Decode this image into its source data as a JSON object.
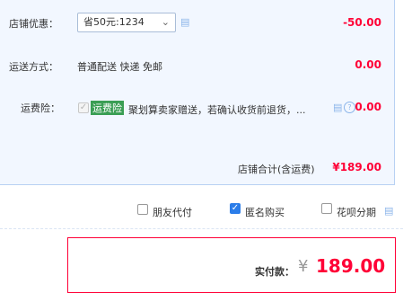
{
  "discount": {
    "label": "店铺优惠：",
    "select_value": "省50元:1234",
    "amount": "-50.00"
  },
  "shipping": {
    "label": "运送方式：",
    "method": "普通配送 快递 免邮",
    "amount": "0.00"
  },
  "insurance": {
    "label": "运费险：",
    "tag": "运费险",
    "description": "聚划算卖家赠送，若确认收货前退货，...",
    "amount": "0.00"
  },
  "store_total": {
    "label": "店铺合计(含运费)",
    "amount": "¥189.00"
  },
  "options": {
    "friend_pay": "朋友代付",
    "anonymous": "匿名购买",
    "installment": "花呗分期"
  },
  "payment": {
    "label": "实付款：",
    "currency": "¥",
    "amount": "189.00"
  },
  "colors": {
    "accent_red": "#ff0036",
    "panel_bg": "#f2f7ff",
    "checkbox_blue": "#2b7de9",
    "tag_green": "#3a9e54"
  }
}
